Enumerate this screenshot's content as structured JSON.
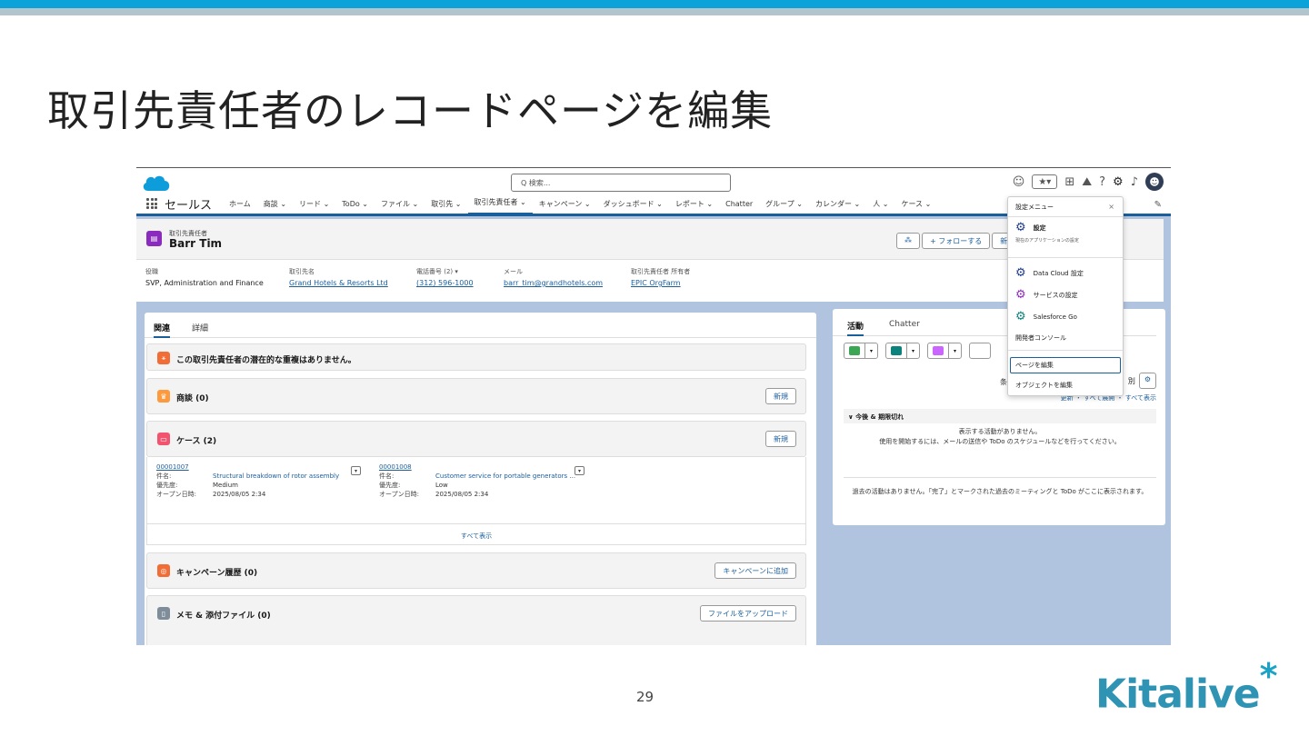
{
  "slide": {
    "title": "取引先責任者のレコードページを編集",
    "page_number": "29",
    "logo_text": "Kitalive",
    "logo_mark": "*"
  },
  "sf": {
    "search_placeholder": "Q 検索...",
    "app_name": "セールス",
    "nav": [
      {
        "label": "ホーム"
      },
      {
        "label": "商談 ⌄"
      },
      {
        "label": "リード ⌄"
      },
      {
        "label": "ToDo ⌄"
      },
      {
        "label": "ファイル ⌄"
      },
      {
        "label": "取引先 ⌄"
      },
      {
        "label": "取引先責任者 ⌄",
        "active": true
      },
      {
        "label": "キャンペーン ⌄"
      },
      {
        "label": "ダッシュボード ⌄"
      },
      {
        "label": "レポート ⌄"
      },
      {
        "label": "Chatter"
      },
      {
        "label": "グループ ⌄"
      },
      {
        "label": "カレンダー ⌄"
      },
      {
        "label": "人 ⌄"
      },
      {
        "label": "ケース ⌄"
      }
    ],
    "record": {
      "type_label": "取引先責任者",
      "name": "Barr Tim",
      "follow_label": "+ フォローする",
      "new_label": "新",
      "fields": [
        {
          "label": "役職",
          "value": "SVP, Administration and Finance",
          "link": false
        },
        {
          "label": "取引先名",
          "value": "Grand Hotels & Resorts Ltd",
          "link": true
        },
        {
          "label": "電話番号 (2) ▾",
          "value": "(312) 596-1000",
          "link": true
        },
        {
          "label": "メール",
          "value": "barr_tim@grandhotels.com",
          "link": true
        },
        {
          "label": "取引先責任者 所有者",
          "value": "EPIC OrgFarm",
          "link": true
        }
      ]
    },
    "left_tabs": {
      "related": "関連",
      "detail": "詳細"
    },
    "dup_message": "この取引先責任者の潜在的な重複はありません。",
    "opps": {
      "title": "商談 (0)",
      "button": "新規"
    },
    "cases": {
      "title": "ケース (2)",
      "button": "新規",
      "items": [
        {
          "num": "00001007",
          "k1": "件名:",
          "v1": "Structural breakdown of rotor assembly",
          "k2": "優先度:",
          "v2": "Medium",
          "k3": "オープン日時:",
          "v3": "2025/08/05 2:34"
        },
        {
          "num": "00001008",
          "k1": "件名:",
          "v1": "Customer service for portable generators ...",
          "k2": "優先度:",
          "v2": "Low",
          "k3": "オープン日時:",
          "v3": "2025/08/05 2:34"
        }
      ],
      "show_all": "すべて表示"
    },
    "campaign": {
      "title": "キャンペーン履歴 (0)",
      "button": "キャンペーンに追加"
    },
    "notes": {
      "title": "メモ & 添付ファイル (0)",
      "button": "ファイルをアップロード"
    },
    "activity": {
      "tab1": "活動",
      "tab2": "Chatter",
      "filter_prefix": "条",
      "filter_suffix": "別",
      "links": "更新 ・ すべて展開 ・ すべて表示",
      "section": "∨ 今後 & 期限切れ",
      "empty1": "表示する活動がありません。",
      "empty2": "使用を開始するには、メールの送信や ToDo のスケジュールなどを行ってください。",
      "past": "過去の活動はありません。「完了」とマークされた過去のミーティングと ToDo がここに表示されます。"
    },
    "menu": {
      "title": "設定メニュー",
      "close": "×",
      "setup": "設定",
      "setup_sub": "現在のアプリケーションの設定",
      "data_cloud": "Data Cloud 設定",
      "service": "サービスの設定",
      "sfgo": "Salesforce Go",
      "dev_console": "開発者コンソール",
      "edit_page": "ページを編集",
      "edit_object": "オブジェクトを編集"
    },
    "colors": {
      "accent": "#1b5e9c",
      "contact_icon": "#8b2bbd",
      "opp_icon": "#fc9a3d",
      "case_icon": "#f2536e",
      "campaign_icon": "#f26d35"
    }
  }
}
